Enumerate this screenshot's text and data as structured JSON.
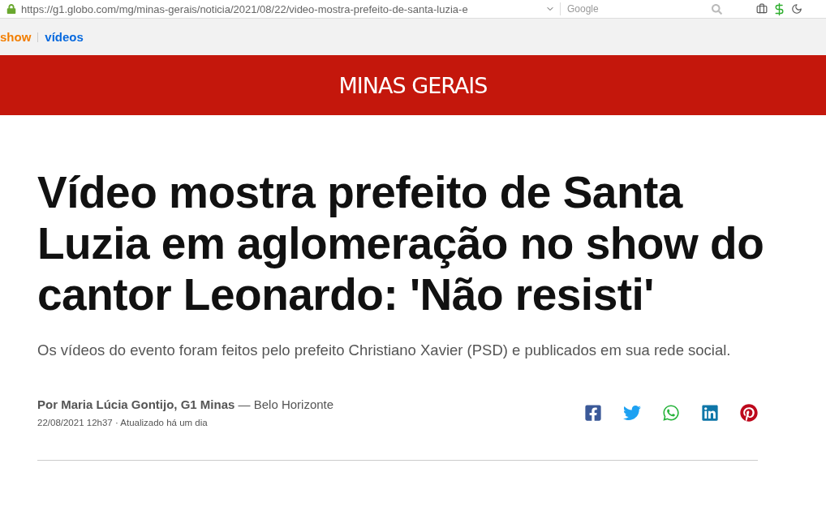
{
  "browser": {
    "url": "https://g1.globo.com/mg/minas-gerais/noticia/2021/08/22/video-mostra-prefeito-de-santa-luzia-e",
    "search": {
      "placeholder": "Google"
    }
  },
  "nav": [
    {
      "label": "show",
      "kind": "section"
    },
    {
      "label": "vídeos",
      "kind": "videos"
    }
  ],
  "banner": {
    "title": "MINAS GERAIS"
  },
  "article": {
    "headline": "Vídeo mostra prefeito de Santa Luzia em aglomeração no show do cantor Leonardo: 'Não resisti'",
    "subtitle": "Os vídeos do evento foram feitos pelo prefeito Christiano Xavier (PSD) e publicados em sua rede social.",
    "byline": "**Por Maria Lúcia Gontijo, G1 Minas** — Belo Horizonte",
    "date": "22/08/2021 12h37 · Atualizado há um dia"
  },
  "share_buttons": [
    {
      "kind": "facebook"
    },
    {
      "kind": "twitter"
    },
    {
      "kind": "whatsapp"
    },
    {
      "kind": "linkedin"
    },
    {
      "kind": "pinterest"
    }
  ]
}
